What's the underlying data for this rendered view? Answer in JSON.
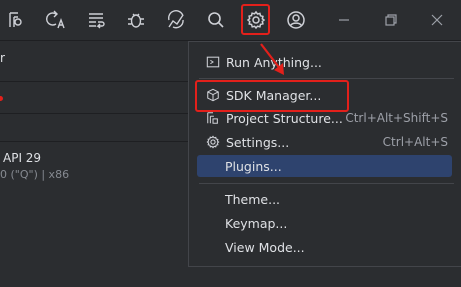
{
  "toolbar": {
    "icons": [
      "project-structure-icon",
      "translate-icon",
      "text-format-icon",
      "debug-bug-icon",
      "graph-icon",
      "search-icon",
      "settings-gear-icon",
      "account-icon"
    ]
  },
  "left_panel": {
    "fragment_top": "r",
    "api_label": "API 29",
    "api_sub": "0 (\"Q\") | x86"
  },
  "menu": {
    "items": [
      {
        "label": "Run Anything...",
        "shortcut": "",
        "icon": "run-anything-icon"
      },
      {
        "label": "SDK Manager...",
        "shortcut": "",
        "icon": "sdk-manager-icon"
      },
      {
        "label": "Project Structure...",
        "shortcut": "Ctrl+Alt+Shift+S",
        "icon": "project-structure-icon"
      },
      {
        "label": "Settings...",
        "shortcut": "Ctrl+Alt+S",
        "icon": "settings-gear-icon"
      },
      {
        "label": "Plugins...",
        "shortcut": "",
        "icon": ""
      },
      {
        "label": "Theme...",
        "shortcut": "",
        "icon": ""
      },
      {
        "label": "Keymap...",
        "shortcut": "",
        "icon": ""
      },
      {
        "label": "View Mode...",
        "shortcut": "",
        "icon": ""
      }
    ],
    "selected_item": "Plugins..."
  },
  "colors": {
    "background": "#2b2d30",
    "highlight_red": "#e3201b",
    "selected_bg": "#2e436e"
  }
}
